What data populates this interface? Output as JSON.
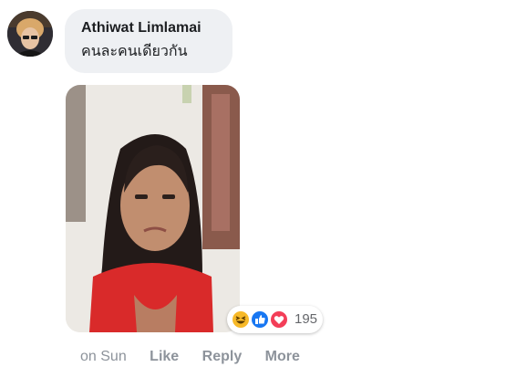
{
  "comment": {
    "author": "Athiwat Limlamai",
    "text": "คนละคนเดียวกัน"
  },
  "reactions": {
    "icons": [
      "haha-icon",
      "like-icon",
      "love-icon"
    ],
    "count": "195",
    "colors": {
      "haha": "#f7b928",
      "like": "#1877f2",
      "love": "#f33e58"
    }
  },
  "actions": {
    "timestamp": "on Sun",
    "like": "Like",
    "reply": "Reply",
    "more": "More"
  },
  "colors": {
    "bubble_bg": "#eef0f3",
    "muted_text": "#8d939b",
    "primary_text": "#1c1e21"
  }
}
